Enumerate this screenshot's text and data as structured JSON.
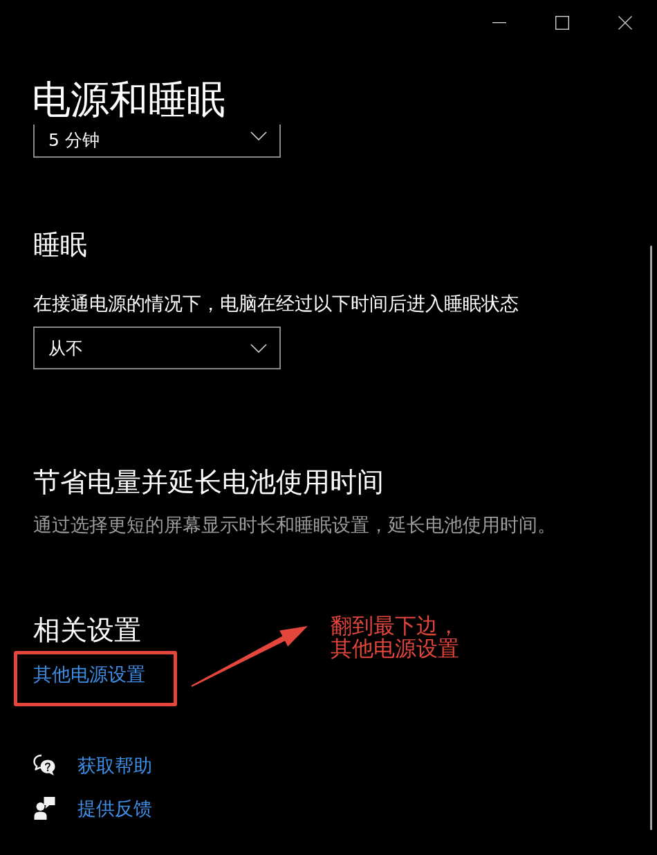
{
  "page": {
    "title": "电源和睡眠"
  },
  "top_dropdown": {
    "value": "5 分钟"
  },
  "sleep": {
    "heading": "睡眠",
    "label": "在接通电源的情况下，电脑在经过以下时间后进入睡眠状态",
    "dropdown": {
      "value": "从不"
    }
  },
  "battery": {
    "heading": "节省电量并延长电池使用时间",
    "description": "通过选择更短的屏幕显示时长和睡眠设置，延长电池使用时间。"
  },
  "related_settings": {
    "heading": "相关设置",
    "links": [
      {
        "label": "其他电源设置"
      }
    ]
  },
  "help_links": [
    {
      "kind": "help",
      "label": "获取帮助"
    },
    {
      "kind": "feedback",
      "label": "提供反馈"
    }
  ],
  "annotation": {
    "text": "翻到最下边，其他电源设置"
  }
}
